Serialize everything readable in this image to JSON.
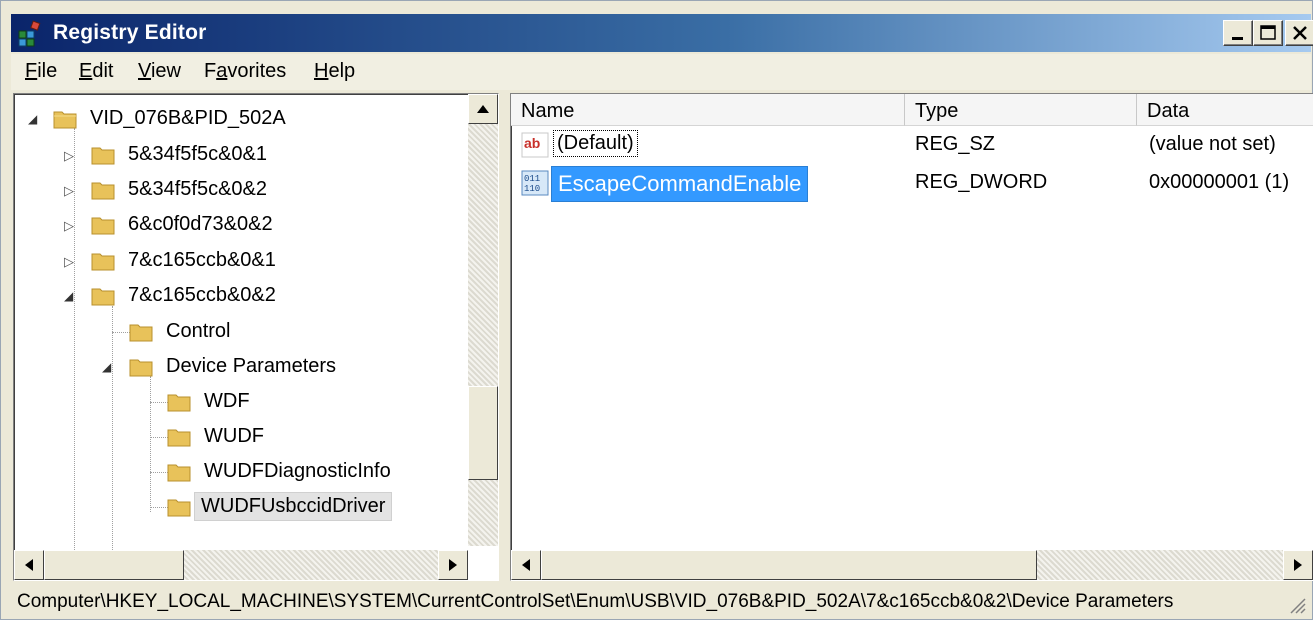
{
  "window": {
    "title": "Registry Editor"
  },
  "menu": {
    "items": [
      {
        "label": "File",
        "accel": "F",
        "rest": "ile"
      },
      {
        "label": "Edit",
        "accel": "E",
        "rest": "dit"
      },
      {
        "label": "View",
        "accel": "V",
        "rest": "iew"
      },
      {
        "label": "Favorites",
        "accel": "a",
        "pre": "F",
        "rest": "vorites"
      },
      {
        "label": "Help",
        "accel": "H",
        "rest": "elp"
      }
    ]
  },
  "tree": {
    "nodes": [
      {
        "label": "VID_076B&PID_502A",
        "expanded": true
      },
      {
        "label": "5&34f5f5c&0&1",
        "expanded": false
      },
      {
        "label": "5&34f5f5c&0&2",
        "expanded": false
      },
      {
        "label": "6&c0f0d73&0&2",
        "expanded": false
      },
      {
        "label": "7&c165ccb&0&1",
        "expanded": false
      },
      {
        "label": "7&c165ccb&0&2",
        "expanded": true
      },
      {
        "label": "Control"
      },
      {
        "label": "Device Parameters",
        "expanded": true
      },
      {
        "label": "WDF"
      },
      {
        "label": "WUDF"
      },
      {
        "label": "WUDFDiagnosticInfo"
      },
      {
        "label": "WUDFUsbccidDriver",
        "selected": true
      }
    ]
  },
  "list": {
    "columns": [
      "Name",
      "Type",
      "Data"
    ],
    "rows": [
      {
        "name": "(Default)",
        "type": "REG_SZ",
        "data": "(value not set)",
        "icon": "string-value-icon"
      },
      {
        "name": "EscapeCommandEnable",
        "type": "REG_DWORD",
        "data": "0x00000001 (1)",
        "icon": "binary-value-icon",
        "selected": true
      }
    ]
  },
  "status": {
    "path": "Computer\\HKEY_LOCAL_MACHINE\\SYSTEM\\CurrentControlSet\\Enum\\USB\\VID_076B&PID_502A\\7&c165ccb&0&2\\Device Parameters"
  },
  "colors": {
    "title_bar_start": "#0a246a",
    "title_bar_end": "#a6caf0",
    "selection": "#3399ff",
    "folder": "#e8c25a"
  }
}
